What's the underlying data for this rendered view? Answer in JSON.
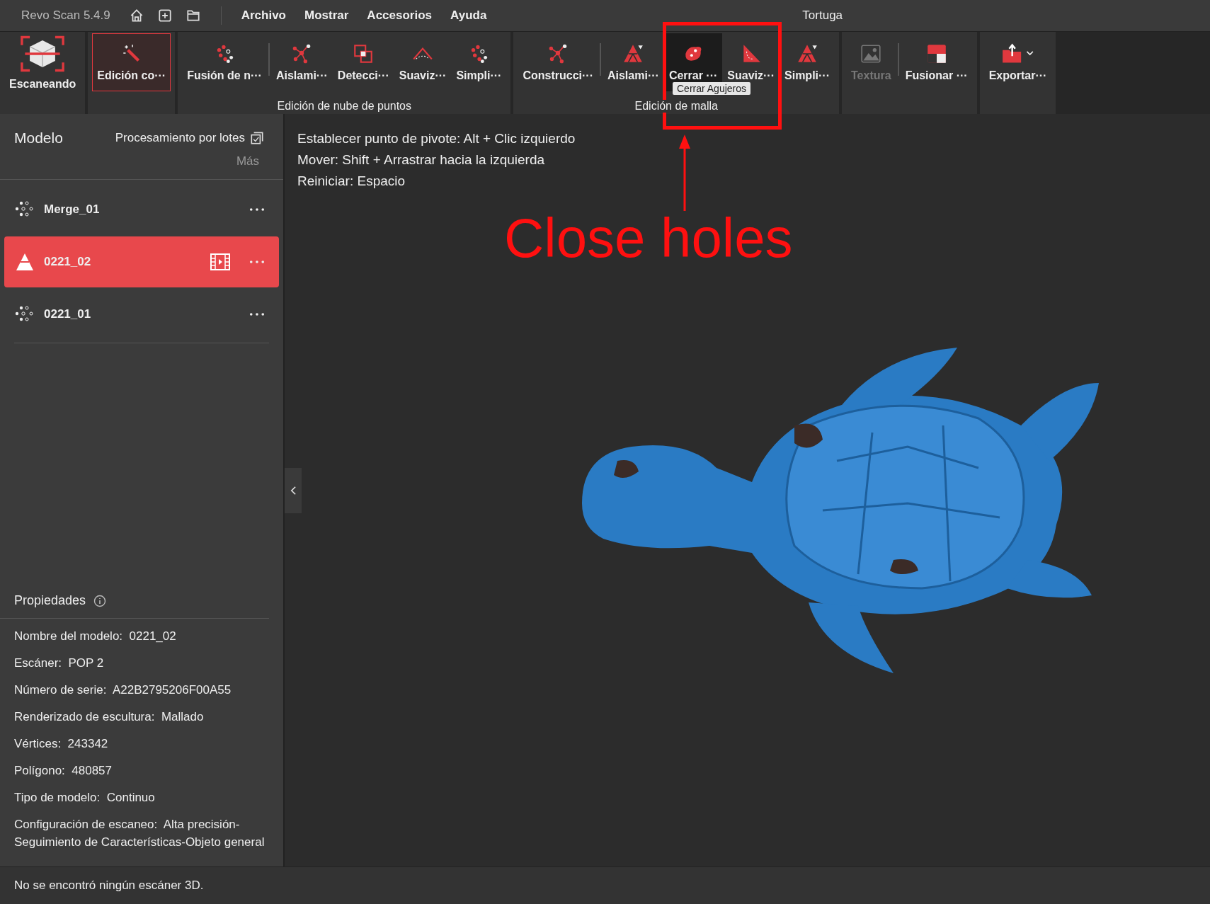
{
  "title_bar": {
    "app": "Revo Scan 5.4.9",
    "menu": [
      "Archivo",
      "Mostrar",
      "Accesorios",
      "Ayuda"
    ],
    "project": "Tortuga"
  },
  "toolbar": {
    "groups": [
      {
        "tools": [
          {
            "label": "Escaneando",
            "selected": false,
            "disabled": false,
            "hovered": false,
            "separator_before": false
          }
        ]
      },
      {
        "tools": [
          {
            "label": "Edición co···",
            "selected": true,
            "disabled": false,
            "hovered": false,
            "separator_before": false
          }
        ]
      },
      {
        "label": "Edición de nube de puntos",
        "tools": [
          {
            "label": "Fusión de n···",
            "selected": false,
            "disabled": false,
            "hovered": false,
            "separator_before": false
          },
          {
            "label": "Aislami···",
            "selected": false,
            "disabled": false,
            "hovered": false,
            "separator_before": true
          },
          {
            "label": "Detecci···",
            "selected": false,
            "disabled": false,
            "hovered": false,
            "separator_before": false
          },
          {
            "label": "Suaviz···",
            "selected": false,
            "disabled": false,
            "hovered": false,
            "separator_before": false
          },
          {
            "label": "Simpli···",
            "selected": false,
            "disabled": false,
            "hovered": false,
            "separator_before": false
          }
        ]
      },
      {
        "label": "Edición de malla",
        "tools": [
          {
            "label": "Construcci···",
            "selected": false,
            "disabled": false,
            "hovered": false,
            "separator_before": false
          },
          {
            "label": "Aislami···",
            "selected": false,
            "disabled": false,
            "hovered": false,
            "separator_before": true
          },
          {
            "label": "Cerrar ···",
            "selected": false,
            "disabled": false,
            "hovered": true,
            "separator_before": false
          },
          {
            "label": "Suaviz···",
            "selected": false,
            "disabled": false,
            "hovered": false,
            "separator_before": false
          },
          {
            "label": "Simpli···",
            "selected": false,
            "disabled": false,
            "hovered": false,
            "separator_before": false
          }
        ]
      },
      {
        "tools": [
          {
            "label": "Textura",
            "selected": false,
            "disabled": true,
            "hovered": false,
            "separator_before": false
          },
          {
            "label": "Fusionar ···",
            "selected": false,
            "disabled": false,
            "hovered": false,
            "separator_before": true
          }
        ]
      },
      {
        "tools": [
          {
            "label": "Exportar···",
            "selected": false,
            "disabled": false,
            "hovered": false,
            "separator_before": false
          }
        ]
      }
    ],
    "tooltip": "Cerrar Agujeros"
  },
  "model_panel": {
    "title": "Modelo",
    "batch": "Procesamiento por lotes",
    "more": "Más",
    "items": [
      {
        "name": "Merge_01",
        "kind": "cloud",
        "selected": false
      },
      {
        "name": "0221_02",
        "kind": "mesh",
        "selected": true
      },
      {
        "name": "0221_01",
        "kind": "cloud",
        "selected": false
      }
    ]
  },
  "properties": {
    "title": "Propiedades",
    "rows": [
      {
        "label": "Nombre del modelo:",
        "value": "0221_02"
      },
      {
        "label": "Escáner:",
        "value": "POP 2"
      },
      {
        "label": "Número de serie:",
        "value": "A22B2795206F00A55"
      },
      {
        "label": "Renderizado de escultura:",
        "value": "Mallado"
      },
      {
        "label": "Vértices:",
        "value": "243342"
      },
      {
        "label": "Polígono:",
        "value": "480857"
      },
      {
        "label": "Tipo de modelo:",
        "value": "Continuo"
      },
      {
        "label": "Configuración de escaneo:",
        "value": "Alta precisión-Seguimiento de Características-Objeto general"
      }
    ]
  },
  "viewport": {
    "hints": [
      "Establecer punto de pivote: Alt + Clic izquierdo",
      "Mover: Shift + Arrastrar hacia la izquierda",
      "Reiniciar: Espacio"
    ]
  },
  "annotation": {
    "text": "Close holes"
  },
  "status_bar": "No se encontró ningún escáner 3D."
}
